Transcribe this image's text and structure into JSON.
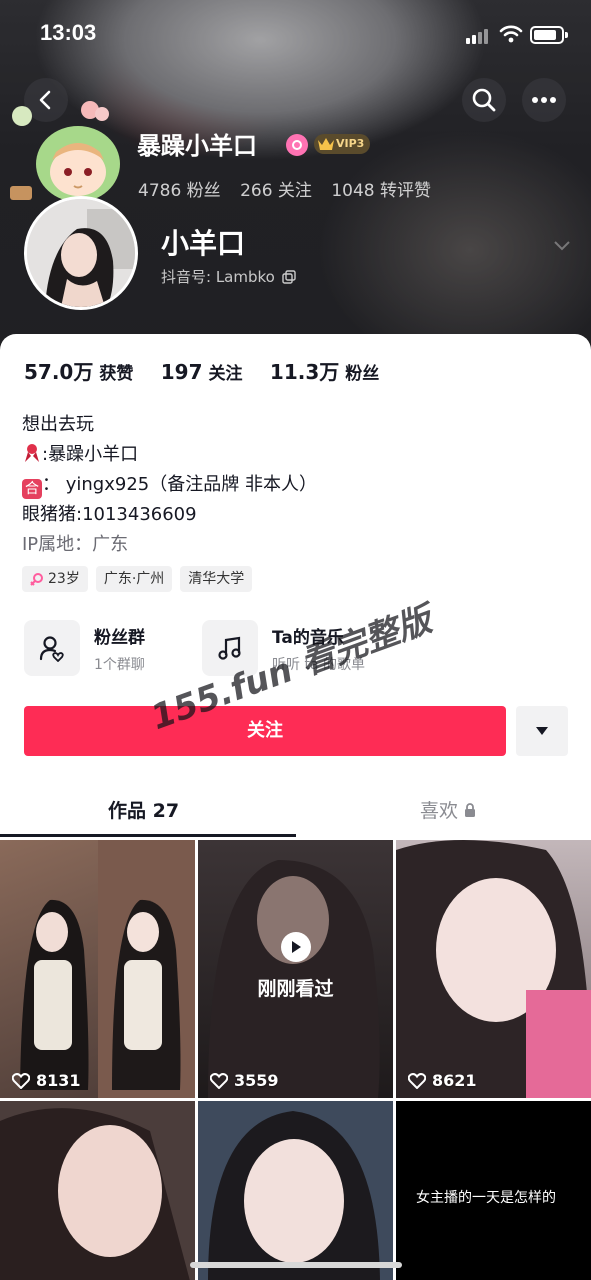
{
  "status_bar": {
    "time": "13:03"
  },
  "header": {
    "fan_group_name": "暴躁小羊口",
    "vip_label": "VIP3",
    "fan_stats": [
      "4786 粉丝",
      "266 关注",
      "1048 转评赞"
    ],
    "nickname": "小羊口",
    "douyin_id": "抖音号: Lambko"
  },
  "stats": [
    {
      "value": "57.0万",
      "label": "获赞"
    },
    {
      "value": "197",
      "label": "关注"
    },
    {
      "value": "11.3万",
      "label": "粉丝"
    }
  ],
  "bio": {
    "line1": "想出去玩",
    "line2": ":暴躁小羊口",
    "line3": "： yingx925（备注品牌 非本人）",
    "line4": "眼猪猪:1013436609",
    "line5": "IP属地：广东"
  },
  "tags": [
    "23岁",
    "广东·广州",
    "清华大学"
  ],
  "features": {
    "fans": {
      "title": "粉丝群",
      "subtitle": "1个群聊"
    },
    "music": {
      "title": "Ta的音乐",
      "subtitle": "听听 ta 的歌单"
    }
  },
  "follow_label": "关注",
  "watermark": "155.fun 看完整版",
  "tabs": {
    "works": "作品 27",
    "likes": "喜欢"
  },
  "videos": [
    {
      "likes": "8131"
    },
    {
      "likes": "3559",
      "overlay": "刚刚看过"
    },
    {
      "likes": "8621"
    },
    {},
    {},
    {
      "caption": "女主播的一天是怎样的"
    }
  ],
  "colors": {
    "accent": "#fe2c55",
    "text": "#161823",
    "secondary": "#8a8b91"
  }
}
